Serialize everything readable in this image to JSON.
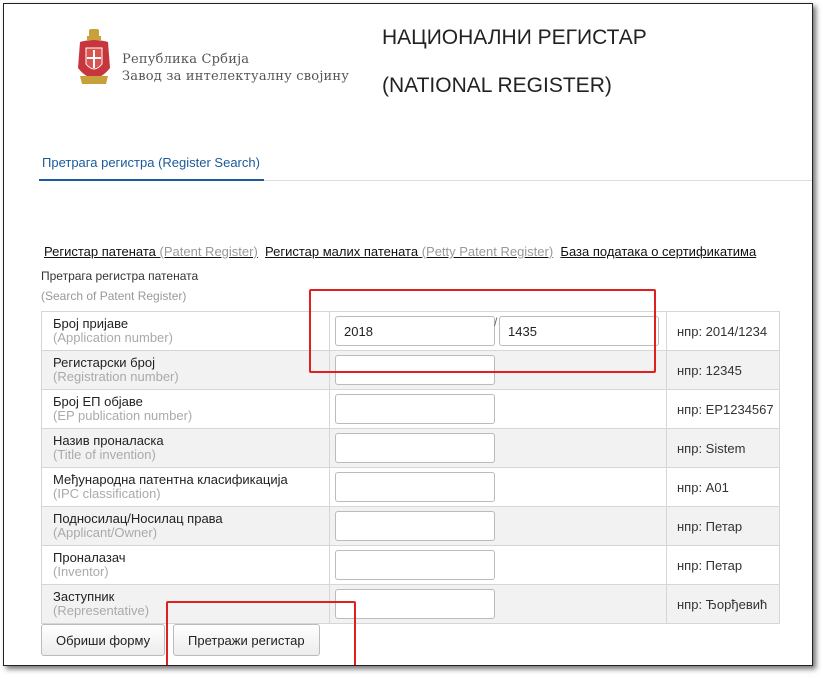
{
  "header": {
    "org_line1": "Република Србија",
    "org_line2": "Завод за интелектуалну својину",
    "title_line1": "НАЦИОНАЛНИ РЕГИСТАР",
    "title_line2": "(NATIONAL REGISTER)"
  },
  "tabs": [
    {
      "label": "Претрага регистра (Register Search)",
      "active": true
    }
  ],
  "registers": [
    {
      "label": "Регистар патената",
      "label_en": "(Patent Register)"
    },
    {
      "label": "Регистар малих патената",
      "label_en": "(Petty Patent Register)"
    },
    {
      "label": "База података о сертификатима"
    }
  ],
  "form": {
    "title": "Претрага регистра патената",
    "subtitle": "(Search of Patent Register)",
    "rows": [
      {
        "label": "Број пријаве",
        "label_en": "(Application number)",
        "value": "2018",
        "value2": "1435",
        "separator": "/",
        "example": "нпр: 2014/1234"
      },
      {
        "label": "Регистарски број",
        "label_en": "(Registration number)",
        "value": "",
        "example": "нпр: 12345"
      },
      {
        "label": "Број ЕП објаве",
        "label_en": "(EP publication number)",
        "value": "",
        "example": "нпр: EP1234567"
      },
      {
        "label": "Назив проналаска",
        "label_en": "(Title of invention)",
        "value": "",
        "example": "нпр: Sistem"
      },
      {
        "label": "Међународна патентна класификација",
        "label_en": "(IPC classification)",
        "value": "",
        "example": "нпр: A01"
      },
      {
        "label": "Подносилац/Носилац права",
        "label_en": "(Applicant/Owner)",
        "value": "",
        "example": "нпр: Петар"
      },
      {
        "label": "Проналазач",
        "label_en": "(Inventor)",
        "value": "",
        "example": "нпр: Петар"
      },
      {
        "label": "Заступник",
        "label_en": "(Representative)",
        "value": "",
        "example": "нпр: Ђорђевић"
      }
    ],
    "clear_button": "Обриши форму",
    "search_button": "Претражи регистар"
  },
  "colors": {
    "link": "#1a5a9a",
    "highlight": "#e02020",
    "coat_red": "#c6363c"
  },
  "icons": {
    "coat_of_arms": "serbian-coat-of-arms-icon"
  }
}
